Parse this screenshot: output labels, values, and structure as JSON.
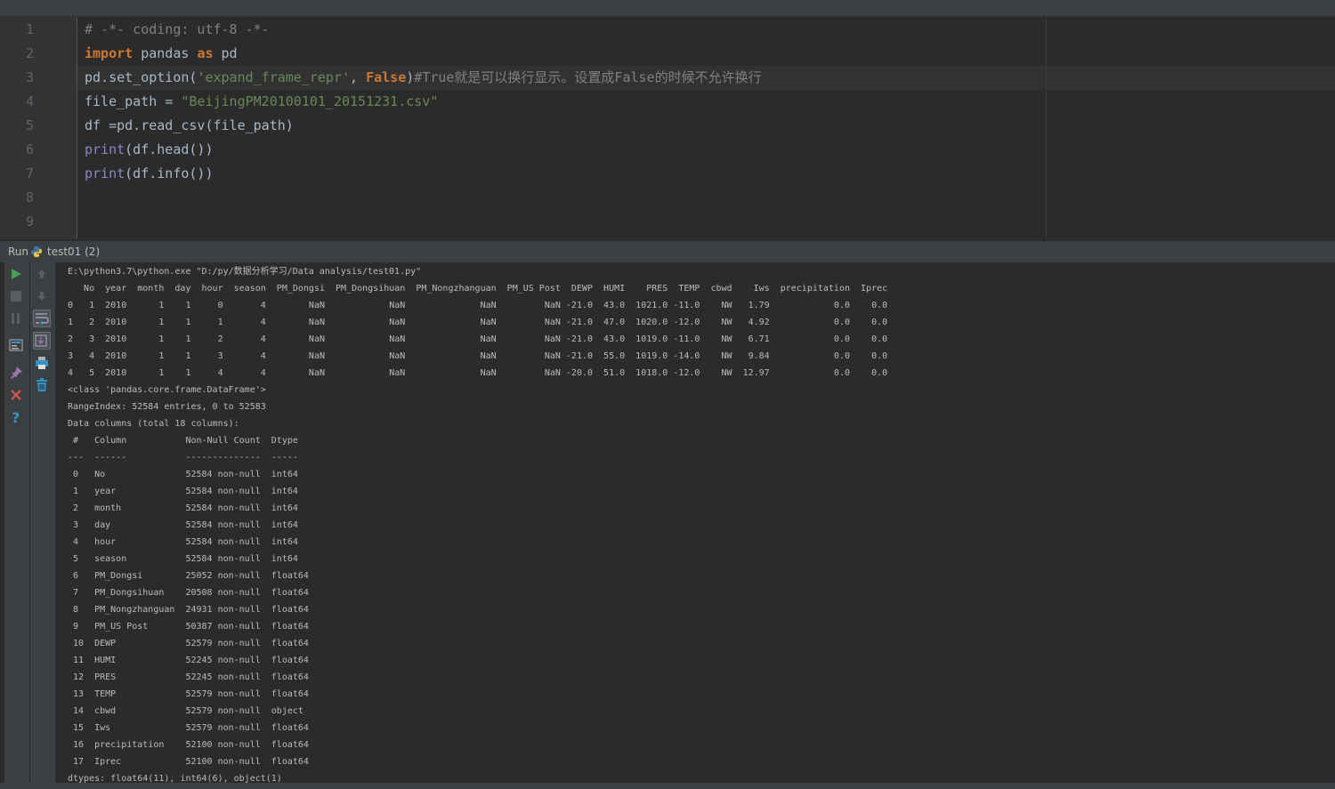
{
  "editor": {
    "line_numbers": [
      "1",
      "2",
      "3",
      "4",
      "5",
      "6",
      "7",
      "8",
      "9"
    ],
    "lines": [
      [
        {
          "t": "# -*- coding: utf-8 -*-",
          "c": "cmt"
        }
      ],
      [
        {
          "t": "import",
          "c": "kw"
        },
        {
          "t": " pandas ",
          "c": ""
        },
        {
          "t": "as",
          "c": "kw"
        },
        {
          "t": " pd",
          "c": ""
        }
      ],
      [
        {
          "t": "pd.set_option(",
          "c": ""
        },
        {
          "t": "'expand_frame_repr'",
          "c": "str"
        },
        {
          "t": ", ",
          "c": ""
        },
        {
          "t": "False",
          "c": "kw"
        },
        {
          "t": ")",
          "c": ""
        },
        {
          "t": "#True就是可以换行显示。设置成False的时候不允许换行",
          "c": "cmt"
        }
      ],
      [
        {
          "t": "file_path = ",
          "c": ""
        },
        {
          "t": "\"BeijingPM20100101_20151231.csv\"",
          "c": "str"
        }
      ],
      [
        {
          "t": "df =pd.read_csv(file_path)",
          "c": ""
        }
      ],
      [
        {
          "t": "print",
          "c": "fn"
        },
        {
          "t": "(df.head())",
          "c": ""
        }
      ],
      [
        {
          "t": "print",
          "c": "fn"
        },
        {
          "t": "(df.info())",
          "c": ""
        }
      ],
      [],
      []
    ]
  },
  "run_panel": {
    "label": "Run",
    "tab_name": "test01 (2)"
  },
  "console": {
    "lines": [
      "E:\\python3.7\\python.exe \"D:/py/数据分析学习/Data analysis/test01.py\"",
      "   No  year  month  day  hour  season  PM_Dongsi  PM_Dongsihuan  PM_Nongzhanguan  PM_US Post  DEWP  HUMI    PRES  TEMP  cbwd    Iws  precipitation  Iprec",
      "0   1  2010      1    1     0       4        NaN            NaN              NaN         NaN -21.0  43.0  1021.0 -11.0    NW   1.79            0.0    0.0",
      "1   2  2010      1    1     1       4        NaN            NaN              NaN         NaN -21.0  47.0  1020.0 -12.0    NW   4.92            0.0    0.0",
      "2   3  2010      1    1     2       4        NaN            NaN              NaN         NaN -21.0  43.0  1019.0 -11.0    NW   6.71            0.0    0.0",
      "3   4  2010      1    1     3       4        NaN            NaN              NaN         NaN -21.0  55.0  1019.0 -14.0    NW   9.84            0.0    0.0",
      "4   5  2010      1    1     4       4        NaN            NaN              NaN         NaN -20.0  51.0  1018.0 -12.0    NW  12.97            0.0    0.0",
      "<class 'pandas.core.frame.DataFrame'>",
      "RangeIndex: 52584 entries, 0 to 52583",
      "Data columns (total 18 columns):",
      " #   Column           Non-Null Count  Dtype  ",
      "---  ------           --------------  -----  ",
      " 0   No               52584 non-null  int64  ",
      " 1   year             52584 non-null  int64  ",
      " 2   month            52584 non-null  int64  ",
      " 3   day              52584 non-null  int64  ",
      " 4   hour             52584 non-null  int64  ",
      " 5   season           52584 non-null  int64  ",
      " 6   PM_Dongsi        25052 non-null  float64",
      " 7   PM_Dongsihuan    20508 non-null  float64",
      " 8   PM_Nongzhanguan  24931 non-null  float64",
      " 9   PM_US Post       50387 non-null  float64",
      " 10  DEWP             52579 non-null  float64",
      " 11  HUMI             52245 non-null  float64",
      " 12  PRES             52245 non-null  float64",
      " 13  TEMP             52579 non-null  float64",
      " 14  cbwd             52579 non-null  object ",
      " 15  Iws              52579 non-null  float64",
      " 16  precipitation    52100 non-null  float64",
      " 17  Iprec            52100 non-null  float64",
      "dtypes: float64(11), int64(6), object(1)"
    ]
  },
  "colors": {
    "run_green": "#499c54",
    "close_red": "#c75450",
    "help_blue": "#3592c4",
    "python_blue": "#3e7ab8",
    "python_yellow": "#f2c744"
  }
}
